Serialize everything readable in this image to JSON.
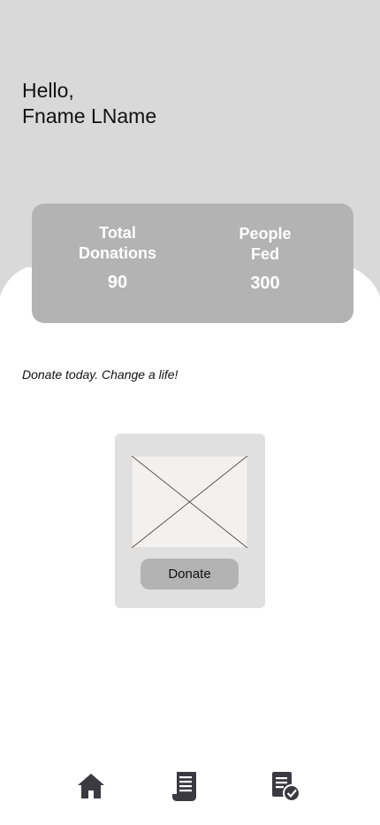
{
  "greeting": {
    "line1": "Hello,",
    "line2": "Fname LName"
  },
  "stats": [
    {
      "label": "Total\nDonations",
      "value": "90"
    },
    {
      "label": "People\nFed",
      "value": "300"
    }
  ],
  "tagline": "Donate today. Change a life!",
  "donate_card": {
    "button_label": "Donate"
  },
  "nav": [
    {
      "icon": "home-icon"
    },
    {
      "icon": "receipt-icon"
    },
    {
      "icon": "report-check-icon"
    }
  ],
  "colors": {
    "hero_bg": "#d9d9d9",
    "card_bg": "#b3b3b3",
    "donate_card_bg": "#e0e0e0",
    "placeholder_bg": "#f3f1f0",
    "icon": "#3a3a40"
  }
}
